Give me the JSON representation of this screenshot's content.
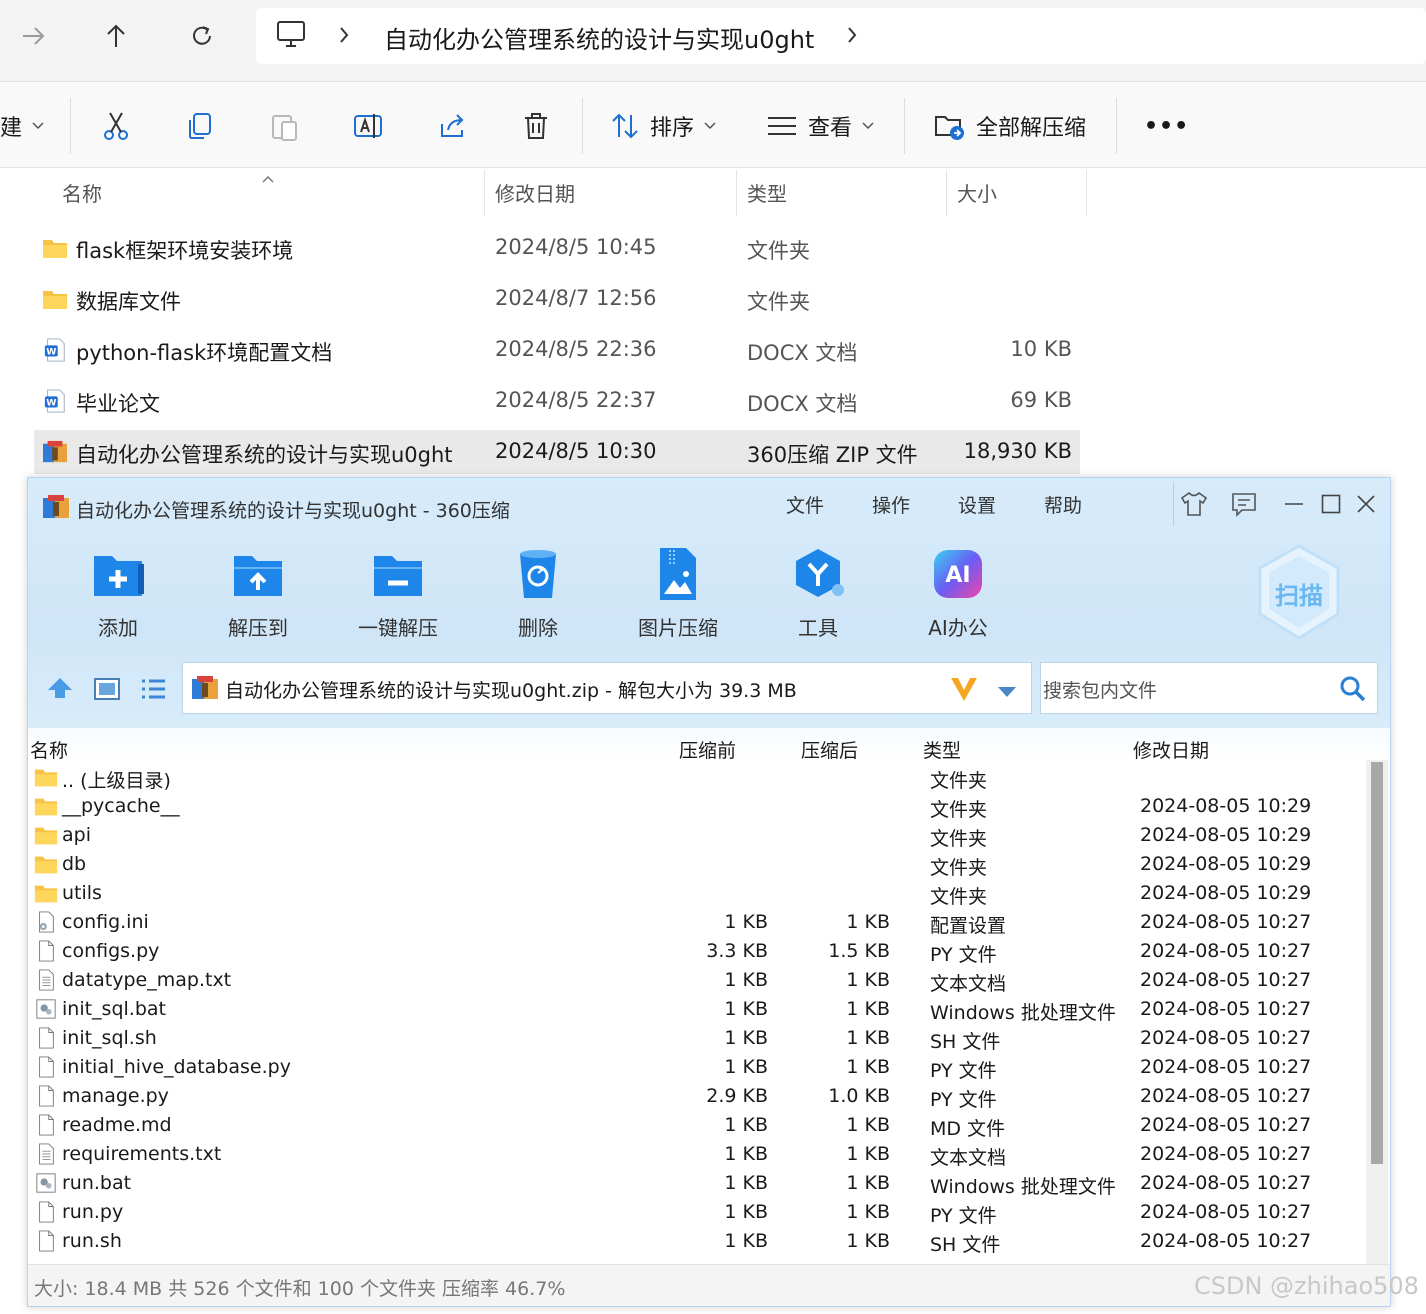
{
  "explorer": {
    "address_path": "自动化办公管理系统的设计与实现u0ght",
    "toolbar": {
      "new_partial": "建",
      "sort_label": "排序",
      "view_label": "查看",
      "extract_all_label": "全部解压缩",
      "more_label": "•••"
    },
    "columns": {
      "name": "名称",
      "date": "修改日期",
      "type": "类型",
      "size": "大小"
    },
    "files": [
      {
        "name": "flask框架环境安装环境",
        "date": "2024/8/5 10:45",
        "type": "文件夹",
        "size": "",
        "icon": "folder-icon"
      },
      {
        "name": "数据库文件",
        "date": "2024/8/7 12:56",
        "type": "文件夹",
        "size": "",
        "icon": "folder-icon"
      },
      {
        "name": "python-flask环境配置文档",
        "date": "2024/8/5 22:36",
        "type": "DOCX 文档",
        "size": "10 KB",
        "icon": "word-doc-icon"
      },
      {
        "name": "毕业论文",
        "date": "2024/8/5 22:37",
        "type": "DOCX 文档",
        "size": "69 KB",
        "icon": "word-doc-icon"
      },
      {
        "name": "自动化办公管理系统的设计与实现u0ght",
        "date": "2024/8/5 10:30",
        "type": "360压缩 ZIP 文件",
        "size": "18,930 KB",
        "icon": "zip-archive-icon",
        "selected": true
      }
    ]
  },
  "zip": {
    "title": "自动化办公管理系统的设计与实现u0ght - 360压缩",
    "menu": [
      "文件",
      "操作",
      "设置",
      "帮助"
    ],
    "tools": [
      "添加",
      "解压到",
      "一键解压",
      "删除",
      "图片压缩",
      "工具",
      "AI办公"
    ],
    "scan_label": "扫描",
    "path": "自动化办公管理系统的设计与实现u0ght.zip - 解包大小为 39.3 MB",
    "search_placeholder": "搜索包内文件",
    "columns": {
      "name": "名称",
      "before": "压缩前",
      "after": "压缩后",
      "type": "类型",
      "date": "修改日期"
    },
    "rows": [
      {
        "name": ".. (上级目录)",
        "before": "",
        "after": "",
        "type": "文件夹",
        "date": "",
        "icon": "folder-icon"
      },
      {
        "name": "__pycache__",
        "before": "",
        "after": "",
        "type": "文件夹",
        "date": "2024-08-05 10:29",
        "icon": "folder-icon"
      },
      {
        "name": "api",
        "before": "",
        "after": "",
        "type": "文件夹",
        "date": "2024-08-05 10:29",
        "icon": "folder-icon"
      },
      {
        "name": "db",
        "before": "",
        "after": "",
        "type": "文件夹",
        "date": "2024-08-05 10:29",
        "icon": "folder-icon"
      },
      {
        "name": "utils",
        "before": "",
        "after": "",
        "type": "文件夹",
        "date": "2024-08-05 10:29",
        "icon": "folder-icon"
      },
      {
        "name": "config.ini",
        "before": "1 KB",
        "after": "1 KB",
        "type": "配置设置",
        "date": "2024-08-05 10:27",
        "icon": "settings-file-icon"
      },
      {
        "name": "configs.py",
        "before": "3.3 KB",
        "after": "1.5 KB",
        "type": "PY 文件",
        "date": "2024-08-05 10:27",
        "icon": "file-icon"
      },
      {
        "name": "datatype_map.txt",
        "before": "1 KB",
        "after": "1 KB",
        "type": "文本文档",
        "date": "2024-08-05 10:27",
        "icon": "text-file-icon"
      },
      {
        "name": "init_sql.bat",
        "before": "1 KB",
        "after": "1 KB",
        "type": "Windows 批处理文件",
        "date": "2024-08-05 10:27",
        "icon": "batch-file-icon"
      },
      {
        "name": "init_sql.sh",
        "before": "1 KB",
        "after": "1 KB",
        "type": "SH 文件",
        "date": "2024-08-05 10:27",
        "icon": "file-icon"
      },
      {
        "name": "initial_hive_database.py",
        "before": "1 KB",
        "after": "1 KB",
        "type": "PY 文件",
        "date": "2024-08-05 10:27",
        "icon": "file-icon"
      },
      {
        "name": "manage.py",
        "before": "2.9 KB",
        "after": "1.0 KB",
        "type": "PY 文件",
        "date": "2024-08-05 10:27",
        "icon": "file-icon"
      },
      {
        "name": "readme.md",
        "before": "1 KB",
        "after": "1 KB",
        "type": "MD 文件",
        "date": "2024-08-05 10:27",
        "icon": "file-icon"
      },
      {
        "name": "requirements.txt",
        "before": "1 KB",
        "after": "1 KB",
        "type": "文本文档",
        "date": "2024-08-05 10:27",
        "icon": "text-file-icon"
      },
      {
        "name": "run.bat",
        "before": "1 KB",
        "after": "1 KB",
        "type": "Windows 批处理文件",
        "date": "2024-08-05 10:27",
        "icon": "batch-file-icon"
      },
      {
        "name": "run.py",
        "before": "1 KB",
        "after": "1 KB",
        "type": "PY 文件",
        "date": "2024-08-05 10:27",
        "icon": "file-icon"
      },
      {
        "name": "run.sh",
        "before": "1 KB",
        "after": "1 KB",
        "type": "SH 文件",
        "date": "2024-08-05 10:27",
        "icon": "file-icon"
      }
    ],
    "status": "大小: 18.4 MB 共 526 个文件和 100 个文件夹 压缩率 46.7%"
  },
  "watermark": "CSDN @zhihao508",
  "colors": {
    "folder": "#f6c344",
    "accent": "#1e88e5",
    "zip_header": "#d3e8f8",
    "selected_row": "#e9e9e9"
  }
}
